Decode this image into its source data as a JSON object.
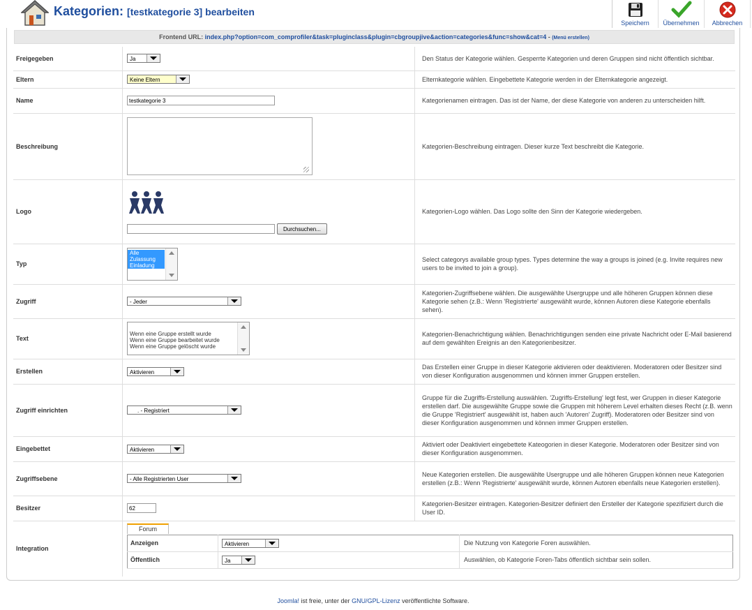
{
  "header": {
    "title": "Kategorien:",
    "subtitle": "[testkategorie 3] bearbeiten"
  },
  "toolbar": {
    "save": "Speichern",
    "apply": "Übernehmen",
    "cancel": "Abbrechen"
  },
  "urlbar": {
    "label": "Frontend URL:",
    "url": "index.php?option=com_comprofiler&task=pluginclass&plugin=cbgroupjive&action=categories&func=show&cat=4",
    "sep": " - ",
    "menu_link": "(Menü erstellen)"
  },
  "rows": {
    "published": {
      "label": "Freigegeben",
      "value": "Ja",
      "desc": "Den Status der Kategorie wählen. Gesperrte Kategorien und deren Gruppen sind nicht öffentlich sichtbar."
    },
    "parent": {
      "label": "Eltern",
      "value": "Keine Eltern",
      "desc": "Elternkategorie wählen. Eingebettete Kategorie werden in der Elternkategorie angezeigt."
    },
    "name": {
      "label": "Name",
      "value": "testkategorie 3",
      "desc": "Kategorienamen eintragen. Das ist der Name, der diese Kategorie von anderen zu unterscheiden hilft."
    },
    "description": {
      "label": "Beschreibung",
      "value": "",
      "desc": "Kategorien-Beschreibung eintragen. Dieser kurze Text beschreibt die Kategorie."
    },
    "logo": {
      "label": "Logo",
      "file_value": "",
      "browse": "Durchsuchen...",
      "desc": "Kategorien-Logo wählen. Das Logo sollte den Sinn der Kategorie wiedergeben."
    },
    "type": {
      "label": "Typ",
      "options": [
        "Alle",
        "Zulassung",
        "Einladung"
      ],
      "desc": "Select categorys available group types. Types determine the way a groups is joined (e.g. Invite requires new users to be invited to join a group)."
    },
    "access": {
      "label": "Zugriff",
      "value": "- Jeder",
      "desc": "Kategorien-Zugriffsebene wählen. Die ausgewählte Usergruppe und alle höheren Gruppen können diese Kategorie sehen (z.B.: Wenn 'Registrierte' ausgewählt wurde, können Autoren diese Kategorie ebenfalls sehen)."
    },
    "text": {
      "label": "Text",
      "options": [
        "Wenn eine Gruppe erstellt wurde",
        "Wenn eine Gruppe bearbeitet wurde",
        "Wenn eine Gruppe gelöscht wurde"
      ],
      "desc": "Kategorien-Benachrichtigung wählen. Benachrichtigungen senden eine private Nachricht oder E-Mail basierend auf dem gewählten Ereignis an den Kategorienbesitzer."
    },
    "create": {
      "label": "Erstellen",
      "value": "Aktivieren",
      "desc": "Das Erstellen einer Gruppe in dieser Kategorie aktivieren oder deaktivieren. Moderatoren oder Besitzer sind von dieser Konfiguration ausgenommen und können immer Gruppen erstellen."
    },
    "create_access": {
      "label": "Zugriff einrichten",
      "value": ". - Registriert",
      "desc": "Gruppe für die Zugriffs-Erstellung auswählen. 'Zugriffs-Erstellung' legt fest, wer Gruppen in dieser Kategorie erstellen darf. Die ausgewählte Gruppe sowie die Gruppen mit höherem Level erhalten dieses Recht (z.B. wenn die Gruppe 'Registriert' ausgewählt ist, haben auch 'Autoren' Zugriff). Moderatoren oder Besitzer sind von dieser Konfiguration ausgenommen und können immer Gruppen erstellen."
    },
    "nested": {
      "label": "Eingebettet",
      "value": "Aktivieren",
      "desc": "Aktiviert oder Deaktiviert eingebettete Kateogorien in dieser Kategorie. Moderatoren oder Besitzer sind von dieser Konfiguration ausgenommen."
    },
    "nested_access": {
      "label": "Zugriffsebene",
      "value": "- Alle Registrierten User",
      "desc": "Neue Kategorien erstellen. Die ausgewählte Usergruppe und alle höheren Gruppen können neue Kategorien erstellen (z.B.: Wenn 'Registrierte' ausgewählt wurde, können Autoren ebenfalls neue Kategorien erstellen)."
    },
    "owner": {
      "label": "Besitzer",
      "value": "62",
      "desc": "Kategorien-Besitzer eintragen. Kategorien-Besitzer definiert den Ersteller der Kategorie spezifiziert durch die User ID."
    },
    "integration": {
      "label": "Integration",
      "tab": "Forum",
      "show": {
        "label": "Anzeigen",
        "value": "Aktivieren",
        "desc": "Die Nutzung von Kategorie Foren auswählen."
      },
      "public": {
        "label": "Öffentlich",
        "value": "Ja",
        "desc": "Auswählen, ob Kategorie Foren-Tabs öffentlich sichtbar sein sollen."
      }
    }
  },
  "footer": {
    "joomla": "Joomla!",
    "text1": " ist freie, unter der ",
    "license": "GNU/GPL-Lizenz",
    "text2": " veröffentlichte Software."
  }
}
